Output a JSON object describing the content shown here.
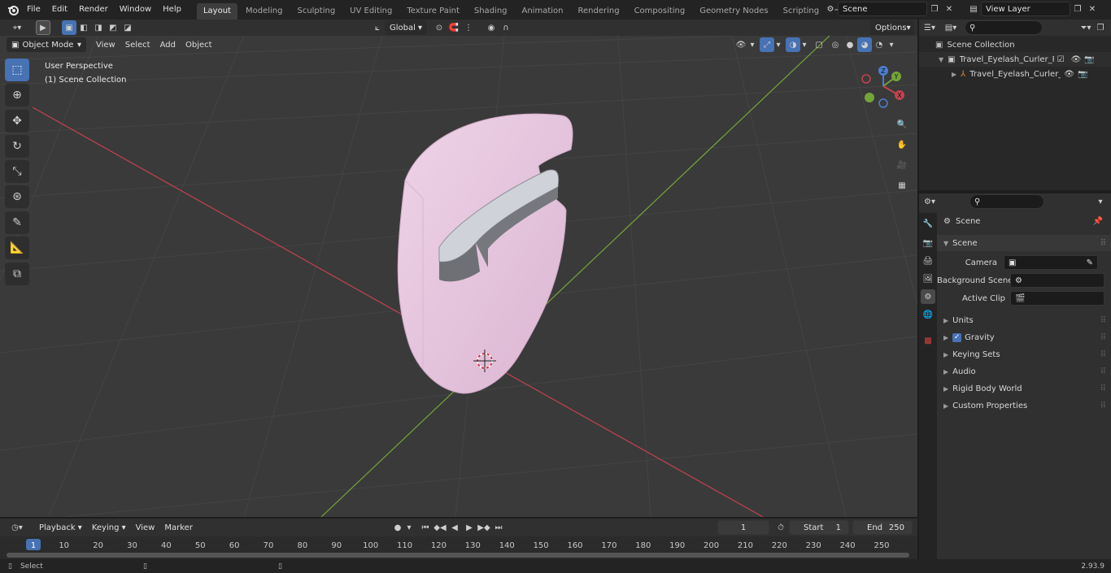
{
  "menu": {
    "file": "File",
    "edit": "Edit",
    "render": "Render",
    "window": "Window",
    "help": "Help"
  },
  "workspaces": [
    "Layout",
    "Modeling",
    "Sculpting",
    "UV Editing",
    "Texture Paint",
    "Shading",
    "Animation",
    "Rendering",
    "Compositing",
    "Geometry Nodes",
    "Scripting"
  ],
  "scene_field": "Scene",
  "view_layer_field": "View Layer",
  "header": {
    "transform_orientation": "Global",
    "options": "Options",
    "mode": "Object Mode",
    "view": "View",
    "select": "Select",
    "add": "Add",
    "object": "Object"
  },
  "viewport": {
    "perspective": "User Perspective",
    "collection": "(1) Scene Collection"
  },
  "gizmo": {
    "z": "Z",
    "y": "Y",
    "x": "X"
  },
  "outliner": {
    "root": "Scene Collection",
    "items": [
      {
        "label": "Travel_Eyelash_Curler_Pink_C"
      },
      {
        "label": "Travel_Eyelash_Curler_Pi"
      }
    ]
  },
  "properties": {
    "context": "Scene",
    "panel": "Scene",
    "camera_label": "Camera",
    "bg_scene_label": "Background Scene",
    "active_clip_label": "Active Clip",
    "sections": [
      "Units",
      "Gravity",
      "Keying Sets",
      "Audio",
      "Rigid Body World",
      "Custom Properties"
    ]
  },
  "timeline": {
    "playback": "Playback",
    "keying": "Keying",
    "view": "View",
    "marker": "Marker",
    "current_frame": "1",
    "start_label": "Start",
    "start_value": "1",
    "end_label": "End",
    "end_value": "250",
    "ticks": [
      "1",
      "10",
      "20",
      "30",
      "40",
      "50",
      "60",
      "70",
      "80",
      "90",
      "100",
      "110",
      "120",
      "130",
      "140",
      "150",
      "160",
      "170",
      "180",
      "190",
      "200",
      "210",
      "220",
      "230",
      "240",
      "250"
    ]
  },
  "status": {
    "select": "Select",
    "version": "2.93.9"
  },
  "colors": {
    "accent": "#4772b3",
    "x_axis": "#c4424f",
    "y_axis": "#74a53a",
    "model": "#e6c6dd"
  }
}
